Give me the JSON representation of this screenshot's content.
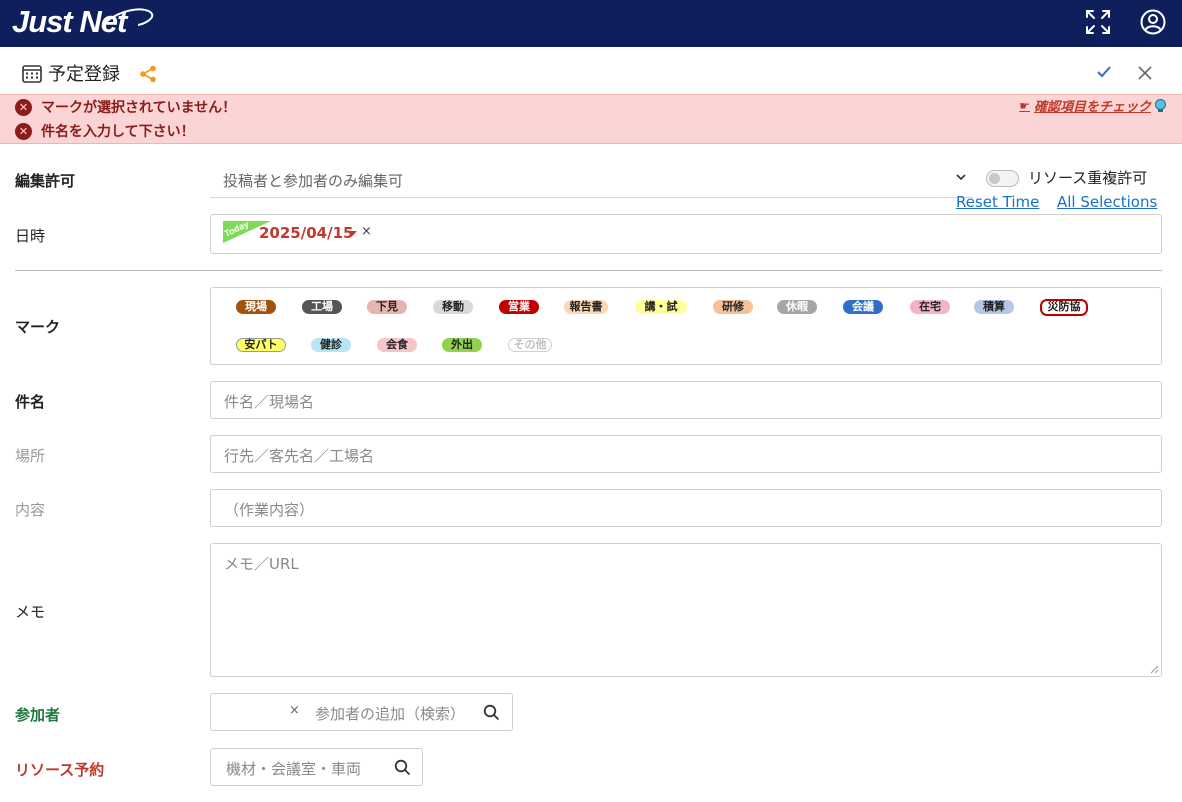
{
  "header": {
    "logo": "Just Net",
    "expand_icon": "expand-icon",
    "account_icon": "user-circle-icon"
  },
  "titlebar": {
    "title": "予定登録",
    "calendar_icon": "calendar-icon",
    "share_icon": "share-icon",
    "confirm_icon": "check-icon",
    "close_icon": "close-icon"
  },
  "errors": {
    "messages": [
      "マークが選択されていません！",
      "件名を入力して下さい！"
    ],
    "check_link": "確認項目をチェック"
  },
  "form": {
    "edit_permission": {
      "label": "編集許可",
      "value": "投稿者と参加者のみ編集可"
    },
    "resource_dup": {
      "label": "リソース重複許可",
      "checked": false
    },
    "reset_time": "Reset Time",
    "all_selections": "All Selections",
    "datetime": {
      "label": "日時",
      "today_badge": "Today",
      "date": "2025/04/15",
      "clear": "×"
    },
    "mark": {
      "label": "マーク",
      "items": [
        {
          "text": "現場",
          "bg": "#a0520f",
          "fg": "#ffffff"
        },
        {
          "text": "工場",
          "bg": "#555555",
          "fg": "#ffffff"
        },
        {
          "text": "下見",
          "bg": "#e8b4ae",
          "fg": "#222222"
        },
        {
          "text": "移動",
          "bg": "#d9d9d9",
          "fg": "#222222"
        },
        {
          "text": "営業",
          "bg": "#c00000",
          "fg": "#ffffff"
        },
        {
          "text": "報告書",
          "bg": "#fad9b0",
          "fg": "#222222"
        },
        {
          "text": "講・試",
          "bg": "#ffff99",
          "fg": "#222222"
        },
        {
          "text": "研修",
          "bg": "#f6c29a",
          "fg": "#222222"
        },
        {
          "text": "休暇",
          "bg": "#a6a6a6",
          "fg": "#ffffff"
        },
        {
          "text": "会議",
          "bg": "#2f6fc8",
          "fg": "#ffffff"
        },
        {
          "text": "在宅",
          "bg": "#f3b3cb",
          "fg": "#222222"
        },
        {
          "text": "積算",
          "bg": "#b4c7e7",
          "fg": "#222222"
        },
        {
          "text": "災防協",
          "bg": "#ffffff",
          "fg": "#222222"
        },
        {
          "text": "安パト",
          "bg": "#ffff66",
          "fg": "#222222"
        },
        {
          "text": "健診",
          "bg": "#b7e6f5",
          "fg": "#222222"
        },
        {
          "text": "会食",
          "bg": "#f5c6c6",
          "fg": "#222222"
        },
        {
          "text": "外出",
          "bg": "#92d050",
          "fg": "#222222"
        },
        {
          "text": "その他",
          "bg": "#ffffff",
          "fg": "#bfbfbf"
        }
      ]
    },
    "subject": {
      "label": "件名",
      "placeholder": "件名／現場名"
    },
    "place": {
      "label": "場所",
      "placeholder": "行先／客先名／工場名"
    },
    "content": {
      "label": "内容",
      "placeholder": "（作業内容）"
    },
    "memo": {
      "label": "メモ",
      "placeholder": "メモ／URL"
    },
    "participants": {
      "label": "参加者",
      "clear": "×",
      "placeholder": "参加者の追加（検索）"
    },
    "resource": {
      "label": "リソース予約",
      "placeholder": "機材・会議室・車両"
    }
  }
}
